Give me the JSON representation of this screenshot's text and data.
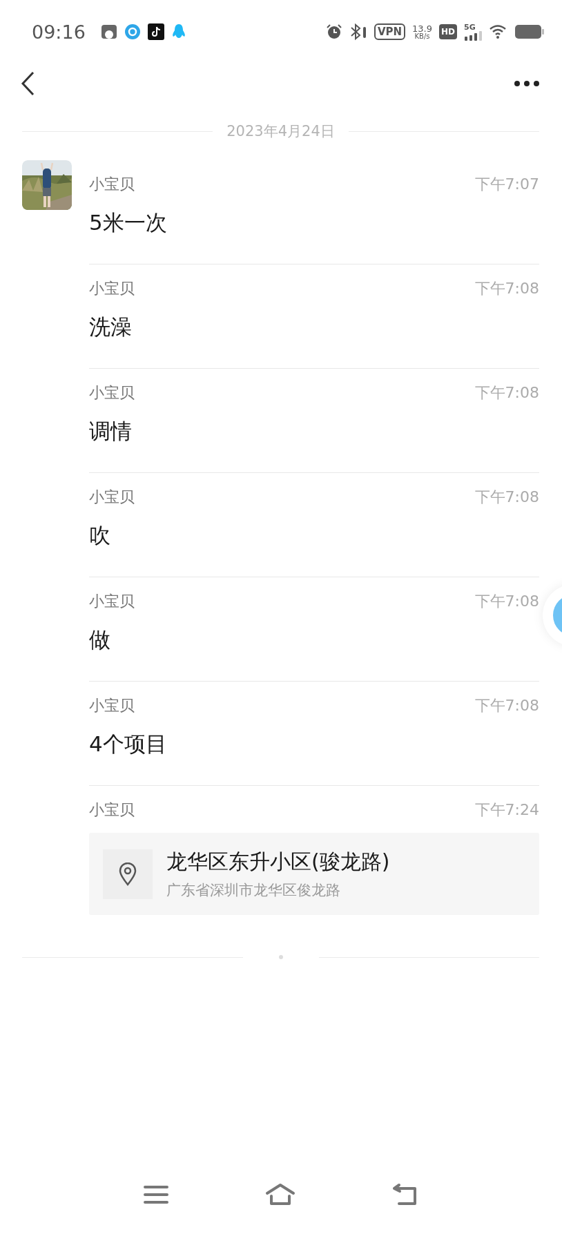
{
  "status_bar": {
    "time": "09:16",
    "speed": "13.9",
    "speed_unit": "KB/s",
    "vpn": "VPN",
    "hd": "HD",
    "network": "5G"
  },
  "date_divider": "2023年4月24日",
  "messages": [
    {
      "kind": "text",
      "avatar": true,
      "name": "小宝贝",
      "time": "下午7:07",
      "text": "5米一次"
    },
    {
      "kind": "text",
      "avatar": false,
      "name": "小宝贝",
      "time": "下午7:08",
      "text": "洗澡"
    },
    {
      "kind": "text",
      "avatar": false,
      "name": "小宝贝",
      "time": "下午7:08",
      "text": "调情"
    },
    {
      "kind": "text",
      "avatar": false,
      "name": "小宝贝",
      "time": "下午7:08",
      "text": "吹"
    },
    {
      "kind": "text",
      "avatar": false,
      "name": "小宝贝",
      "time": "下午7:08",
      "text": "做"
    },
    {
      "kind": "text",
      "avatar": false,
      "name": "小宝贝",
      "time": "下午7:08",
      "text": "4个项目"
    },
    {
      "kind": "location",
      "avatar": false,
      "name": "小宝贝",
      "time": "下午7:24",
      "title": "龙华区东升小区(骏龙路)",
      "address": "广东省深圳市龙华区俊龙路"
    }
  ]
}
